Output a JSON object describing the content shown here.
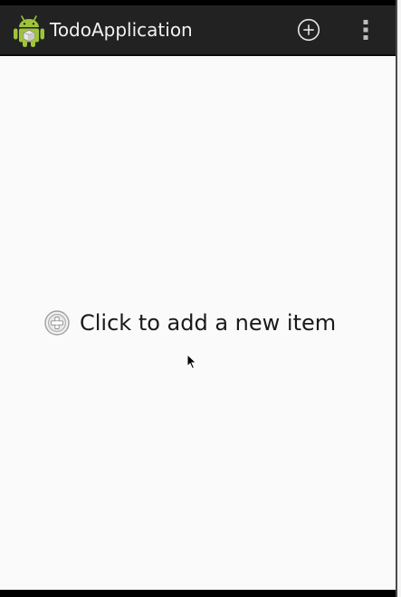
{
  "app": {
    "title": "TodoApplication",
    "icon": "android-robot-icon"
  },
  "action_bar": {
    "background": "#222222",
    "actions": [
      {
        "name": "add",
        "icon": "add-circle-icon"
      },
      {
        "name": "overflow",
        "icon": "overflow-menu-icon"
      }
    ]
  },
  "empty_state": {
    "text": "Click to add a new item",
    "icon": "add-circle-icon"
  },
  "colors": {
    "accent_android_green": "#9fc43a",
    "content_background": "#fafafa"
  }
}
